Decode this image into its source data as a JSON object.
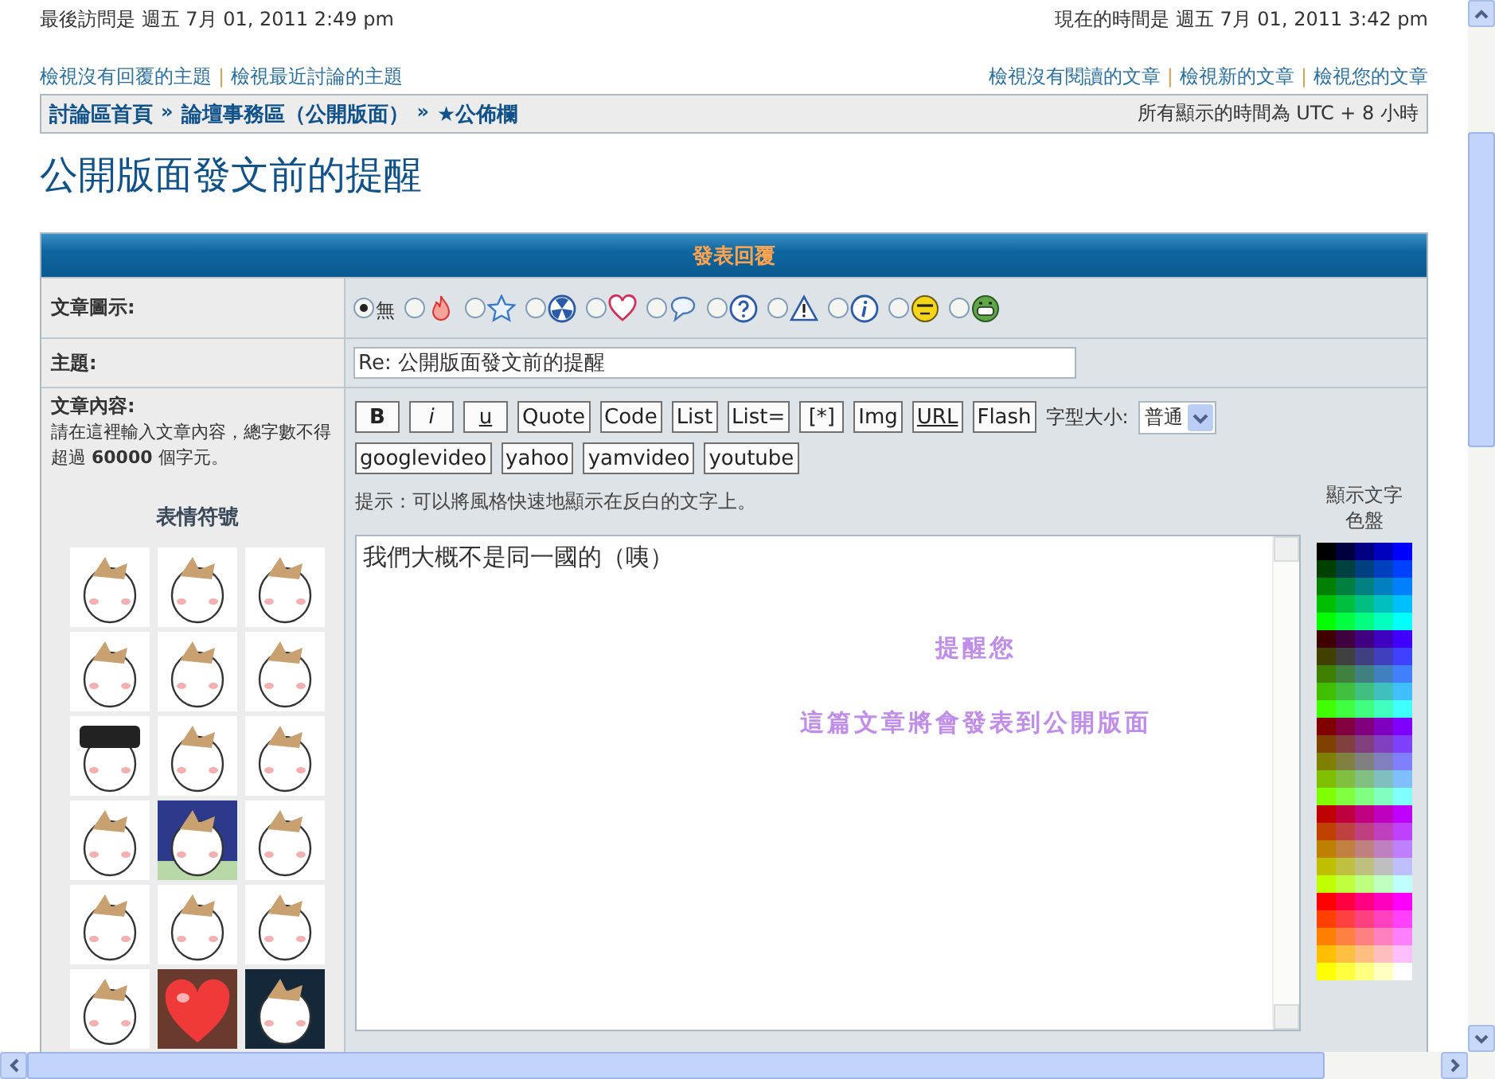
{
  "header": {
    "last_visit": "最後訪問是 週五 7月 01, 2011 2:49 pm",
    "current_time": "現在的時間是 週五 7月 01, 2011 3:42 pm"
  },
  "links_left": [
    "檢視沒有回覆的主題",
    "檢視最近討論的主題"
  ],
  "links_right": [
    "檢視沒有閱讀的文章",
    "檢視新的文章",
    "檢視您的文章"
  ],
  "link_separator": "|",
  "breadcrumbs": [
    "討論區首頁",
    "論壇事務區（公開版面）",
    "★公佈欄"
  ],
  "breadcrumb_separator": "»",
  "timezone": "所有顯示的時間為 UTC + 8 小時",
  "topic_title": "公開版面發文前的提醒",
  "form": {
    "title": "發表回覆",
    "post_icon_label": "文章圖示:",
    "post_icons": [
      {
        "kind": "none",
        "label": "無",
        "selected": true
      },
      {
        "kind": "fire",
        "selected": false
      },
      {
        "kind": "star",
        "selected": false
      },
      {
        "kind": "radioactive",
        "selected": false
      },
      {
        "kind": "heart",
        "selected": false
      },
      {
        "kind": "speech",
        "selected": false
      },
      {
        "kind": "question",
        "selected": false
      },
      {
        "kind": "warning",
        "selected": false
      },
      {
        "kind": "info",
        "selected": false
      },
      {
        "kind": "wink",
        "selected": false
      },
      {
        "kind": "grin",
        "selected": false
      }
    ],
    "subject_label": "主題:",
    "subject_value": "Re: 公開版面發文前的提醒",
    "message_label": "文章內容:",
    "message_hint": "請在這裡輸入文章內容，總字數不得超過 **60000** 個字元。",
    "emoticons_title": "表情符號",
    "emoticons": [
      {
        "kind": "plain"
      },
      {
        "kind": "plain"
      },
      {
        "kind": "plain"
      },
      {
        "kind": "plain"
      },
      {
        "kind": "plain"
      },
      {
        "kind": "plain"
      },
      {
        "kind": "hat"
      },
      {
        "kind": "plain"
      },
      {
        "kind": "plain"
      },
      {
        "kind": "plain"
      },
      {
        "kind": "night"
      },
      {
        "kind": "plain"
      },
      {
        "kind": "plain"
      },
      {
        "kind": "plain"
      },
      {
        "kind": "plain"
      },
      {
        "kind": "plain"
      },
      {
        "kind": "heart"
      },
      {
        "kind": "dark"
      }
    ],
    "format_buttons": [
      {
        "label": "B",
        "kind": "bold"
      },
      {
        "label": "i",
        "kind": "italic"
      },
      {
        "label": "u",
        "kind": "underline"
      },
      {
        "label": "Quote",
        "kind": "plain"
      },
      {
        "label": "Code",
        "kind": "plain"
      },
      {
        "label": "List",
        "kind": "plain"
      },
      {
        "label": "List=",
        "kind": "plain"
      },
      {
        "label": "[*]",
        "kind": "plain"
      },
      {
        "label": "Img",
        "kind": "plain"
      },
      {
        "label": "URL",
        "kind": "underline"
      },
      {
        "label": "Flash",
        "kind": "plain"
      }
    ],
    "font_size_label": "字型大小:",
    "font_size_value": "普通",
    "media_buttons": [
      "googlevideo",
      "yahoo",
      "yamvideo",
      "youtube"
    ],
    "tip": "提示：可以將風格快速地顯示在反白的文字上。",
    "message_value": "我們大概不是同一國的（咦）",
    "notice_lines": [
      "提醒您",
      "這篇文章將會發表到公開版面"
    ],
    "palette_label": "顯示文字色盤"
  }
}
